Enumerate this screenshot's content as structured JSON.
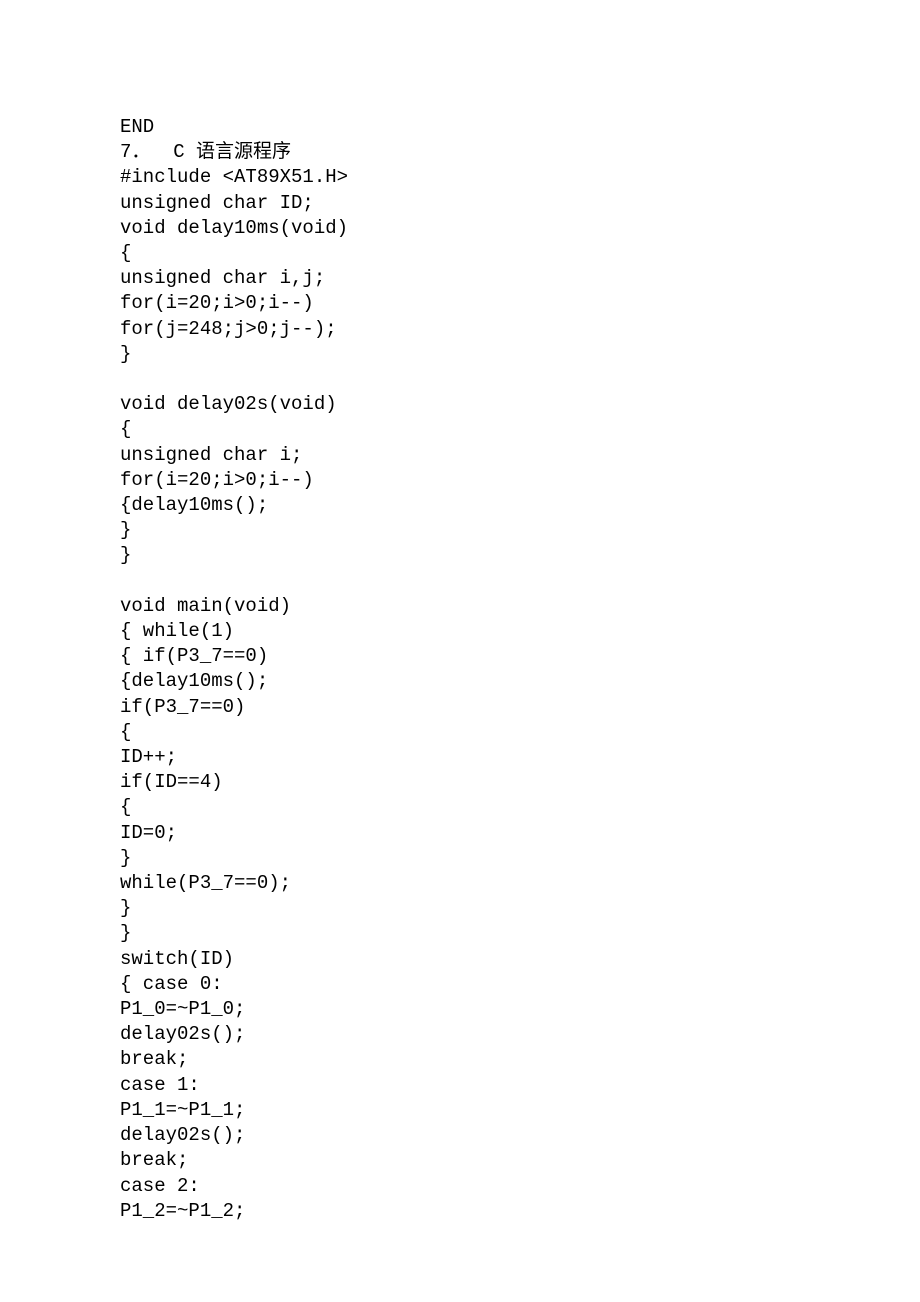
{
  "lines": [
    "END",
    "7．  C 语言源程序",
    "#include <AT89X51.H>",
    "unsigned char ID;",
    "void delay10ms(void)",
    "{",
    "unsigned char i,j;",
    "for(i=20;i>0;i--)",
    "for(j=248;j>0;j--);",
    "}",
    "",
    "void delay02s(void)",
    "{",
    "unsigned char i;",
    "for(i=20;i>0;i--)",
    "{delay10ms();",
    "}",
    "}",
    "",
    "void main(void)",
    "{ while(1)",
    "{ if(P3_7==0)",
    "{delay10ms();",
    "if(P3_7==0)",
    "{",
    "ID++;",
    "if(ID==4)",
    "{",
    "ID=0;",
    "}",
    "while(P3_7==0);",
    "}",
    "}",
    "switch(ID)",
    "{ case 0:",
    "P1_0=~P1_0;",
    "delay02s();",
    "break;",
    "case 1:",
    "P1_1=~P1_1;",
    "delay02s();",
    "break;",
    "case 2:",
    "P1_2=~P1_2;"
  ]
}
